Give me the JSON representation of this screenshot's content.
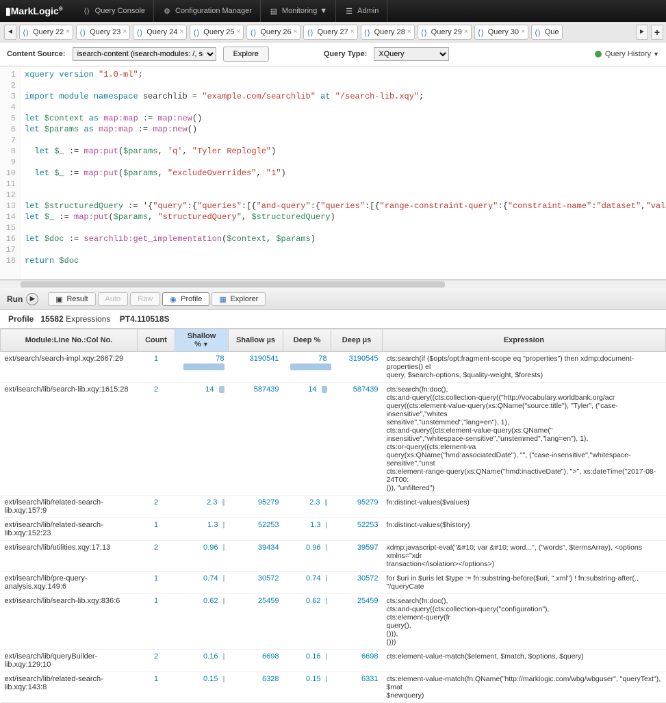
{
  "topnav": {
    "logo": "MarkLogic",
    "items": [
      {
        "icon": "code",
        "label": "Query Console"
      },
      {
        "icon": "gear",
        "label": "Configuration Manager"
      },
      {
        "icon": "monitor",
        "label": "Monitoring",
        "arrow": true
      },
      {
        "icon": "admin",
        "label": "Admin"
      }
    ]
  },
  "tabs": [
    {
      "label": "Query 22"
    },
    {
      "label": "Query 23"
    },
    {
      "label": "Query 24"
    },
    {
      "label": "Query 25"
    },
    {
      "label": "Query 26"
    },
    {
      "label": "Query 27"
    },
    {
      "label": "Query 28"
    },
    {
      "label": "Query 29"
    },
    {
      "label": "Query 30"
    },
    {
      "label": "Que"
    }
  ],
  "toolbar": {
    "content_source_label": "Content Source:",
    "content_source_value": "isearch-content (isearch-modules: /, se",
    "explore": "Explore",
    "query_type_label": "Query Type:",
    "query_type_value": "XQuery",
    "query_history": "Query History"
  },
  "editor_lines": [
    "xquery version \"1.0-ml\";",
    "",
    "import module namespace searchlib = \"example.com/searchlib\" at \"/search-lib.xqy\";",
    "",
    "let $context as map:map := map:new()",
    "let $params as map:map := map:new()",
    "",
    "  let $_ := map:put($params, 'q', \"Tyler Replogle\")",
    "",
    "  let $_ := map:put($params, \"excludeOverrides\", \"1\")",
    "",
    "",
    "let $structuredQuery := '{\"query\":{\"queries\":[{\"and-query\":{\"queries\":[{\"range-constraint-query\":{\"constraint-name\":\"dataset\",\"value\":[\"pe",
    "let $_ := map:put($params, \"structuredQuery\", $structuredQuery)",
    "",
    "let $doc := searchlib:get_implementation($context, $params)",
    "",
    "return $doc"
  ],
  "runbar": {
    "run": "Run",
    "result": "Result",
    "auto": "Auto",
    "raw": "Raw",
    "profile": "Profile",
    "explorer": "Explorer"
  },
  "profile": {
    "label": "Profile",
    "expr_count": "15582",
    "expr_label": "Expressions",
    "time": "PT4.110518S"
  },
  "columns": {
    "module": "Module:Line No.:Col No.",
    "count": "Count",
    "shallow_pct": "Shallow %",
    "shallow_us": "Shallow µs",
    "deep_pct": "Deep %",
    "deep_us": "Deep µs",
    "expression": "Expression"
  },
  "rows": [
    {
      "module": "ext/search/search-impl.xqy:2667:29",
      "count": "1",
      "spc": "78",
      "sbar": 60,
      "sus": "3190541",
      "dpc": "78",
      "dbar": 60,
      "dus": "3190545",
      "expr": "cts:search(if ($opts/opt:fragment-scope eq \"properties\") then xdmp:document-properties() el query, $search-options, $quality-weight, $forests)"
    },
    {
      "module": "ext/isearch/lib/search-lib.xqy:1615:28",
      "count": "2",
      "spc": "14",
      "sbar": 8,
      "sus": "587439",
      "dpc": "14",
      "dbar": 8,
      "dus": "587439",
      "expr": "cts:search(fn:doc(), cts:and-query((cts:collection-query((\"http://vocabulary.worldbank.org/acr query((cts:element-value-query(xs:QName(\"source:title\"), \"Tyler\", (\"case-insensitive\",\"whites sensitive\",\"unstemmed\",\"lang=en\"), 1), cts:and-query((cts:element-value-query(xs:QName(\" insensitive\",\"whitespace-sensitive\",\"unstemmed\",\"lang=en\"), 1), cts:or-query((cts:element-va query(xs:QName(\"hmd:associatedDate\"), \"\", (\"case-insensitive\",\"whitespace-sensitive\",\"unst cts:element-range-query(xs:QName(\"hmd:inactiveDate\"), \">\", xs:dateTime(\"2017-08-24T00: ()), \"unfiltered\")"
    },
    {
      "module": "ext/isearch/lib/related-search-lib.xqy:157:9",
      "count": "2",
      "spc": "2.3",
      "sbar": 3,
      "sus": "95279",
      "dpc": "2.3",
      "dbar": 3,
      "dus": "95279",
      "expr": "fn:distinct-values($values)"
    },
    {
      "module": "ext/isearch/lib/related-search-lib.xqy:152:23",
      "count": "1",
      "spc": "1.3",
      "sbar": 2,
      "sus": "52253",
      "dpc": "1.3",
      "dbar": 2,
      "dus": "52253",
      "expr": "fn:distinct-values($history)"
    },
    {
      "module": "ext/isearch/lib/utilities.xqy:17:13",
      "count": "2",
      "spc": "0.96",
      "sbar": 2,
      "sus": "39434",
      "dpc": "0.96",
      "dbar": 2,
      "dus": "39597",
      "expr": "xdmp:javascript-eval(\"&#10; var &#10; word...\", (\"words\", $termsArray), <options xmlns=\"xdr transaction</isolation></options>)"
    },
    {
      "module": "ext/isearch/lib/pre-query-analysis.xqy:149:6",
      "count": "1",
      "spc": "0.74",
      "sbar": 2,
      "sus": "30572",
      "dpc": "0.74",
      "dbar": 2,
      "dus": "30572",
      "expr": "for $uri in $uris let $type := fn:substring-before($uri, \".xml\") ! fn:substring-after(., \"/queryCate"
    },
    {
      "module": "ext/isearch/lib/search-lib.xqy:836:6",
      "count": "1",
      "spc": "0.62",
      "sbar": 2,
      "sus": "25459",
      "dpc": "0.62",
      "dbar": 2,
      "dus": "25459",
      "expr": "cts:search(fn:doc(), cts:and-query((cts:collection-query(\"configuration\"), cts:element-query(fr query(), ())), ()))"
    },
    {
      "module": "ext/isearch/lib/queryBuilder-lib.xqy:129:10",
      "count": "2",
      "spc": "0.16",
      "sbar": 2,
      "sus": "6698",
      "dpc": "0.16",
      "dbar": 2,
      "dus": "6698",
      "expr": "cts:element-value-match($element, $match, $options, $query)"
    },
    {
      "module": "ext/isearch/lib/related-search-lib.xqy:143:8",
      "count": "1",
      "spc": "0.15",
      "sbar": 2,
      "sus": "6328",
      "dpc": "0.15",
      "dbar": 2,
      "dus": "6331",
      "expr": "cts:element-value-match(fn:QName(\"http://marklogic.com/wbg/wbguser\", \"queryText\"), $mat $newquery)"
    }
  ]
}
